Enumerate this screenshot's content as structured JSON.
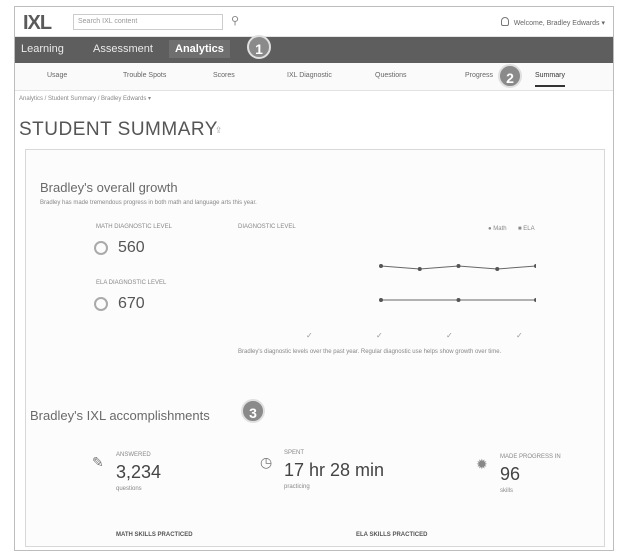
{
  "header": {
    "logo": "IXL",
    "search_placeholder": "Search IXL content",
    "welcome": "Welcome, Bradley Edwards ▾"
  },
  "main_nav": {
    "tabs": [
      "Learning",
      "Assessment",
      "Analytics"
    ],
    "active": "Analytics"
  },
  "sub_nav": {
    "items": [
      "Usage",
      "Trouble Spots",
      "Scores",
      "IXL Diagnostic",
      "Questions",
      "Progress",
      "Summary"
    ],
    "active": "Summary"
  },
  "breadcrumb": "Analytics / Student Summary / Bradley Edwards ▾",
  "page": {
    "title": "STUDENT SUMMARY"
  },
  "callouts": [
    "1",
    "2",
    "3"
  ],
  "growth": {
    "heading": "Bradley's overall growth",
    "description": "Bradley has made tremendous progress in both math and language arts this year.",
    "math_label": "MATH DIAGNOSTIC LEVEL",
    "math_value": "560",
    "ela_label": "ELA DIAGNOSTIC LEVEL",
    "ela_value": "670",
    "chart_label": "DIAGNOSTIC LEVEL",
    "legend_math": "Math",
    "legend_ela": "ELA",
    "note": "Bradley's diagnostic levels over the past year. Regular diagnostic use helps show growth over time."
  },
  "accomplishments": {
    "heading": "Bradley's IXL accomplishments",
    "answered_label": "ANSWERED",
    "answered_value": "3,234",
    "answered_unit": "questions",
    "spent_label": "SPENT",
    "spent_value": "17 hr 28 min",
    "spent_unit": "practicing",
    "progressed_label": "MADE PROGRESS IN",
    "progressed_value": "96",
    "progressed_unit": "skills",
    "math_practiced": "MATH SKILLS PRACTICED",
    "ela_practiced": "ELA SKILLS PRACTICED"
  },
  "chart_data": {
    "type": "line",
    "series": [
      {
        "name": "Math",
        "values": [
          560,
          555,
          560,
          555,
          560
        ]
      },
      {
        "name": "ELA",
        "values": [
          670,
          670,
          670
        ]
      }
    ]
  },
  "colors": {
    "nav_bg": "#5e5e5e",
    "callout": "#8a8a8a"
  }
}
